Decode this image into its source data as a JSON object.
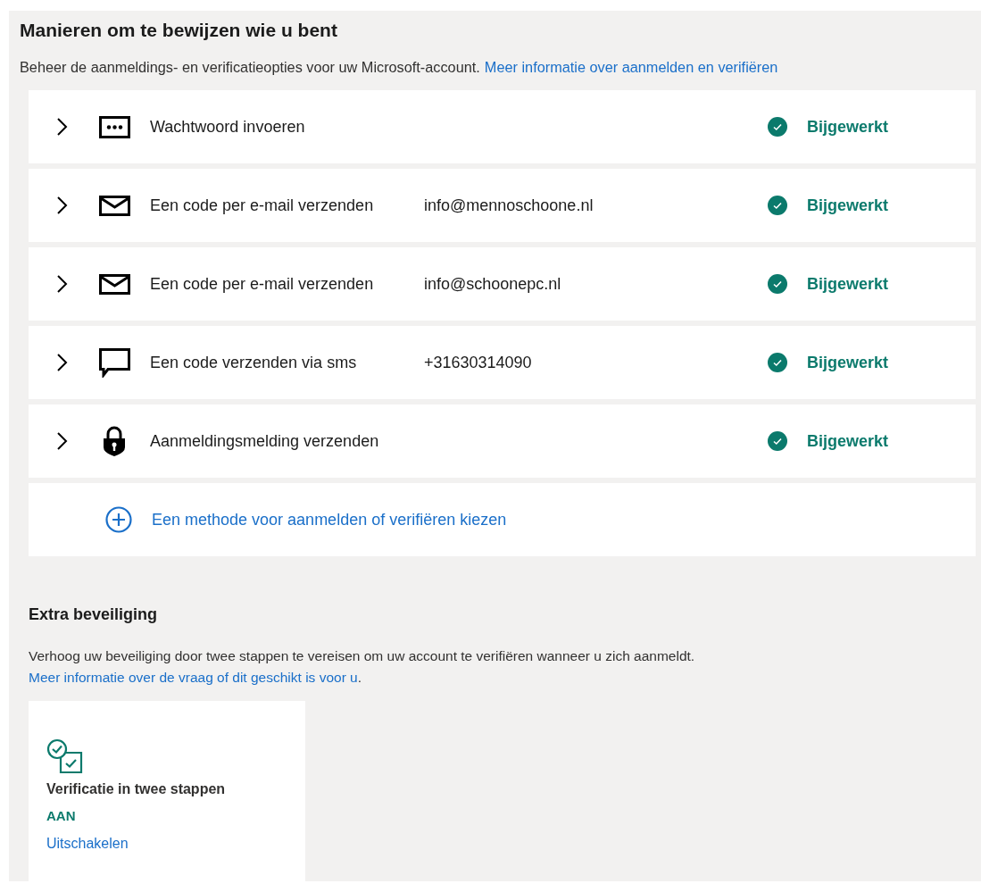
{
  "title": "Manieren om te bewijzen wie u bent",
  "intro": {
    "text": "Beheer de aanmeldings- en verificatieopties voor uw Microsoft-account.",
    "link": "Meer informatie over aanmelden en verifiëren"
  },
  "methods": [
    {
      "kind": "password",
      "label": "Wachtwoord invoeren",
      "status": "Bijgewerkt",
      "expanded": false
    },
    {
      "kind": "email",
      "label": "Een code per e-mail verzenden",
      "detail": "info@mennoschoone.nl",
      "status": "Bijgewerkt",
      "expanded": false
    },
    {
      "kind": "email",
      "label": "Een code per e-mail verzenden",
      "detail": "info@schoonepc.nl",
      "status": "Bijgewerkt",
      "expanded": false
    },
    {
      "kind": "sms",
      "label": "Een code verzenden via sms",
      "detail": "+31630314090",
      "status": "Bijgewerkt",
      "expanded": false
    },
    {
      "kind": "notification",
      "label": "Aanmeldingsmelding verzenden",
      "status": "Bijgewerkt",
      "expanded": false
    }
  ],
  "add_method": "Een methode voor aanmelden of verifiëren kiezen",
  "extra": {
    "title": "Extra beveiliging",
    "text": "Verhoog uw beveiliging door twee stappen te vereisen om uw account te verifiëren wanneer u zich aanmeldt.",
    "link": "Meer informatie over de vraag of dit geschikt is voor u",
    "link_end": ".",
    "card": {
      "title": "Verificatie in twee stappen",
      "state": "AAN",
      "on": true,
      "action": "Uitschakelen"
    }
  }
}
